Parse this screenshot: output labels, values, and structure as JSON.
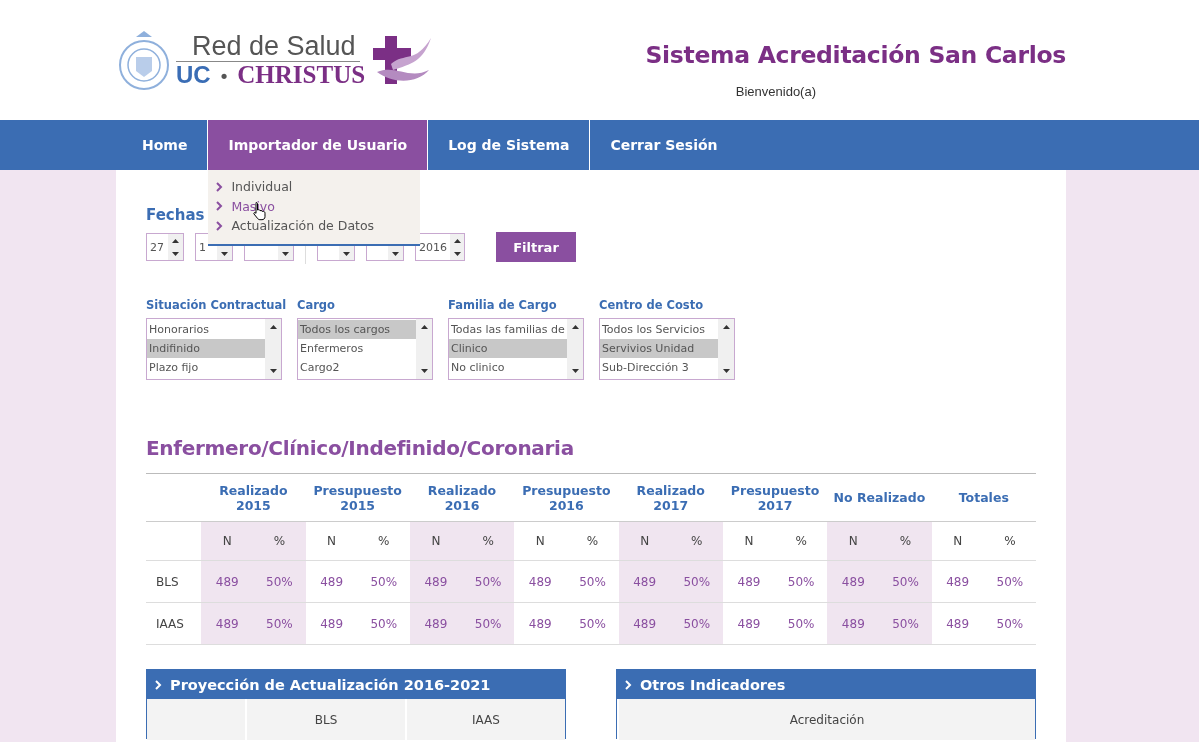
{
  "header": {
    "logo": {
      "line1": "Red de Salud",
      "uc": "UC",
      "dot": "•",
      "christus": "CHRISTUS"
    },
    "title": "Sistema Acreditación San Carlos",
    "welcome": "Bienvenido(a)"
  },
  "nav": [
    {
      "label": "Home",
      "selected": false
    },
    {
      "label": "Importador de Usuario",
      "selected": true,
      "menu": [
        {
          "label": "Individual",
          "hover": false
        },
        {
          "label": "Masivo",
          "hover": true
        },
        {
          "label": "Actualización de Datos",
          "hover": false
        }
      ]
    },
    {
      "label": "Log de Sistema",
      "selected": false
    },
    {
      "label": "Cerrar Sesión",
      "selected": false
    }
  ],
  "dates": {
    "label": "Fechas",
    "from": [
      {
        "value": "27",
        "covered": false
      },
      {
        "value": "1",
        "covered": false
      },
      {
        "covered": true
      }
    ],
    "to": [
      {
        "covered": true
      },
      {
        "covered": true
      },
      {
        "value": "2016",
        "covered": false
      }
    ],
    "button": "Filtrar"
  },
  "filters": [
    {
      "label": "Situación Contractual",
      "options": [
        {
          "text": "Honorarios",
          "selected": false
        },
        {
          "text": "Indifinido",
          "selected": true
        },
        {
          "text": "Plazo fijo",
          "selected": false
        }
      ]
    },
    {
      "label": "Cargo",
      "options": [
        {
          "text": "Todos los cargos",
          "selected": true
        },
        {
          "text": "Enfermeros",
          "selected": false
        },
        {
          "text": "Cargo2",
          "selected": false
        }
      ]
    },
    {
      "label": "Familia de Cargo",
      "options": [
        {
          "text": "Todas las familias de",
          "selected": false
        },
        {
          "text": "Clinico",
          "selected": true
        },
        {
          "text": "No clinico",
          "selected": false
        }
      ]
    },
    {
      "label": "Centro de Costo",
      "options": [
        {
          "text": "Todos los Servicios",
          "selected": false
        },
        {
          "text": "Servivios Unidad",
          "selected": true
        },
        {
          "text": "Sub-Dirección 3",
          "selected": false
        }
      ]
    }
  ],
  "section_title": "Enfermero/Clínico/Indefinido/Coronaria",
  "table": {
    "groups": [
      {
        "label": "Realizado\n2015",
        "shaded": true
      },
      {
        "label": "Presupuesto\n2015",
        "shaded": false
      },
      {
        "label": "Realizado\n2016",
        "shaded": true
      },
      {
        "label": "Presupuesto\n2016",
        "shaded": false
      },
      {
        "label": "Realizado\n2017",
        "shaded": true
      },
      {
        "label": "Presupuesto\n2017",
        "shaded": false
      },
      {
        "label": "No Realizado",
        "shaded": true
      },
      {
        "label": "Totales",
        "shaded": false
      }
    ],
    "subheaders": [
      "N",
      "%",
      "N",
      "%",
      "N",
      "%",
      "N",
      "%",
      "N",
      "%",
      "N",
      "%",
      "N",
      "%",
      "N",
      "%"
    ],
    "rows": [
      {
        "label": "BLS",
        "cells": [
          "489",
          "50%",
          "489",
          "50%",
          "489",
          "50%",
          "489",
          "50%",
          "489",
          "50%",
          "489",
          "50%",
          "489",
          "50%",
          "489",
          "50%"
        ]
      },
      {
        "label": "IAAS",
        "cells": [
          "489",
          "50%",
          "489",
          "50%",
          "489",
          "50%",
          "489",
          "50%",
          "489",
          "50%",
          "489",
          "50%",
          "489",
          "50%",
          "489",
          "50%"
        ]
      }
    ]
  },
  "panels": [
    {
      "title": "Proyección de Actualización 2016-2021",
      "columns": [
        "BLS",
        "IAAS"
      ]
    },
    {
      "title": "Otros Indicadores",
      "columns": [
        "Acreditación"
      ]
    }
  ]
}
